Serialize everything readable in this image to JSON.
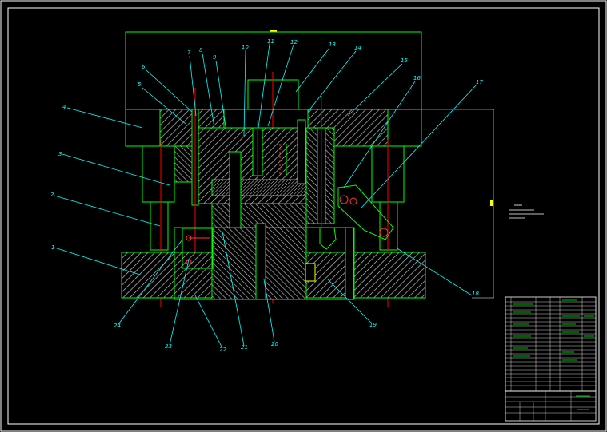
{
  "drawing": {
    "part_labels": [
      {
        "id": "leader-1",
        "text": "1"
      },
      {
        "id": "leader-2",
        "text": "2"
      },
      {
        "id": "leader-3",
        "text": "3"
      },
      {
        "id": "leader-4",
        "text": "4"
      },
      {
        "id": "leader-5",
        "text": "5"
      },
      {
        "id": "leader-6",
        "text": "6"
      },
      {
        "id": "leader-7",
        "text": "7"
      },
      {
        "id": "leader-8",
        "text": "8"
      },
      {
        "id": "leader-9",
        "text": "9"
      },
      {
        "id": "leader-10",
        "text": "10"
      },
      {
        "id": "leader-11",
        "text": "11"
      },
      {
        "id": "leader-12",
        "text": "12"
      },
      {
        "id": "leader-13",
        "text": "13"
      },
      {
        "id": "leader-14",
        "text": "14"
      },
      {
        "id": "leader-15",
        "text": "15"
      },
      {
        "id": "leader-16",
        "text": "16"
      },
      {
        "id": "leader-17",
        "text": "17"
      },
      {
        "id": "leader-18",
        "text": "18"
      },
      {
        "id": "leader-19",
        "text": "19"
      },
      {
        "id": "leader-20",
        "text": "20"
      },
      {
        "id": "leader-21",
        "text": "21"
      },
      {
        "id": "leader-22",
        "text": "22"
      },
      {
        "id": "leader-23",
        "text": "23"
      },
      {
        "id": "leader-24",
        "text": "24"
      }
    ]
  },
  "colors": {
    "background": "#000000",
    "outline": "#00ff00",
    "hatch": "#ffffff",
    "centerline": "#ff0000",
    "leader": "#00ffff",
    "frame": "#ffffff",
    "marker": "#ffff00"
  }
}
